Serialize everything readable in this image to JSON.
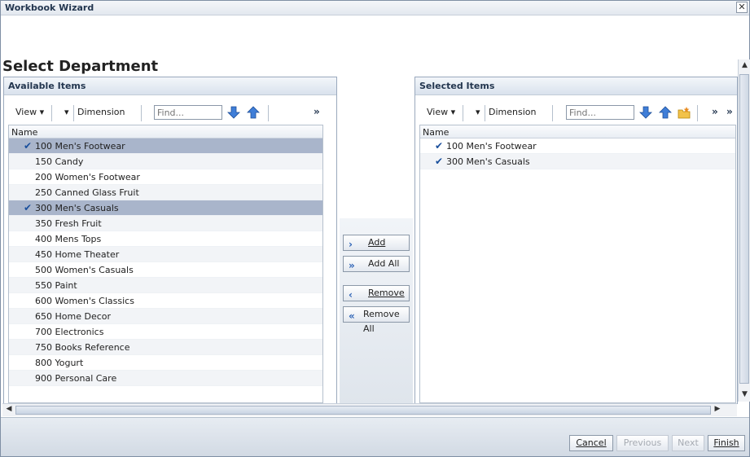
{
  "window": {
    "title": "Workbook Wizard",
    "close_glyph": "✕"
  },
  "page": {
    "heading": "Select Department"
  },
  "available": {
    "title": "Available Items",
    "toolbar": {
      "view_label": "View ▾",
      "dimension_label": "Dimension",
      "find_placeholder": "Find...",
      "more": "»"
    },
    "column_header": "Name",
    "rows": [
      {
        "label": "100 Men's Footwear",
        "selected": true
      },
      {
        "label": "150 Candy",
        "selected": false
      },
      {
        "label": "200 Women's Footwear",
        "selected": false
      },
      {
        "label": "250 Canned Glass Fruit",
        "selected": false
      },
      {
        "label": "300 Men's Casuals",
        "selected": true
      },
      {
        "label": "350 Fresh Fruit",
        "selected": false
      },
      {
        "label": "400 Mens Tops",
        "selected": false
      },
      {
        "label": "450 Home Theater",
        "selected": false
      },
      {
        "label": "500 Women's Casuals",
        "selected": false
      },
      {
        "label": "550 Paint",
        "selected": false
      },
      {
        "label": "600 Women's Classics",
        "selected": false
      },
      {
        "label": "650 Home Decor",
        "selected": false
      },
      {
        "label": "700 Electronics",
        "selected": false
      },
      {
        "label": "750 Books Reference",
        "selected": false
      },
      {
        "label": "800 Yogurt",
        "selected": false
      },
      {
        "label": "900 Personal Care",
        "selected": false
      }
    ]
  },
  "selected": {
    "title": "Selected Items",
    "toolbar": {
      "view_label": "View ▾",
      "dimension_label": "Dimension",
      "find_placeholder": "Find...",
      "more": "»",
      "more2": "»"
    },
    "column_header": "Name",
    "rows": [
      {
        "label": "100 Men's Footwear"
      },
      {
        "label": "300 Men's Casuals"
      }
    ]
  },
  "shuttle": {
    "add": "Add",
    "add_all": "Add All",
    "remove": "Remove",
    "remove_all": "Remove All"
  },
  "footer": {
    "cancel": "Cancel",
    "previous": "Previous",
    "next": "Next",
    "finish": "Finish"
  },
  "icons": {
    "check": "✔",
    "down_arrow": "down-arrow-icon",
    "up_arrow": "up-arrow-icon",
    "folder": "folder-star-icon"
  },
  "colors": {
    "selected_row": "#a9b5cb",
    "accent": "#2d63b6"
  }
}
